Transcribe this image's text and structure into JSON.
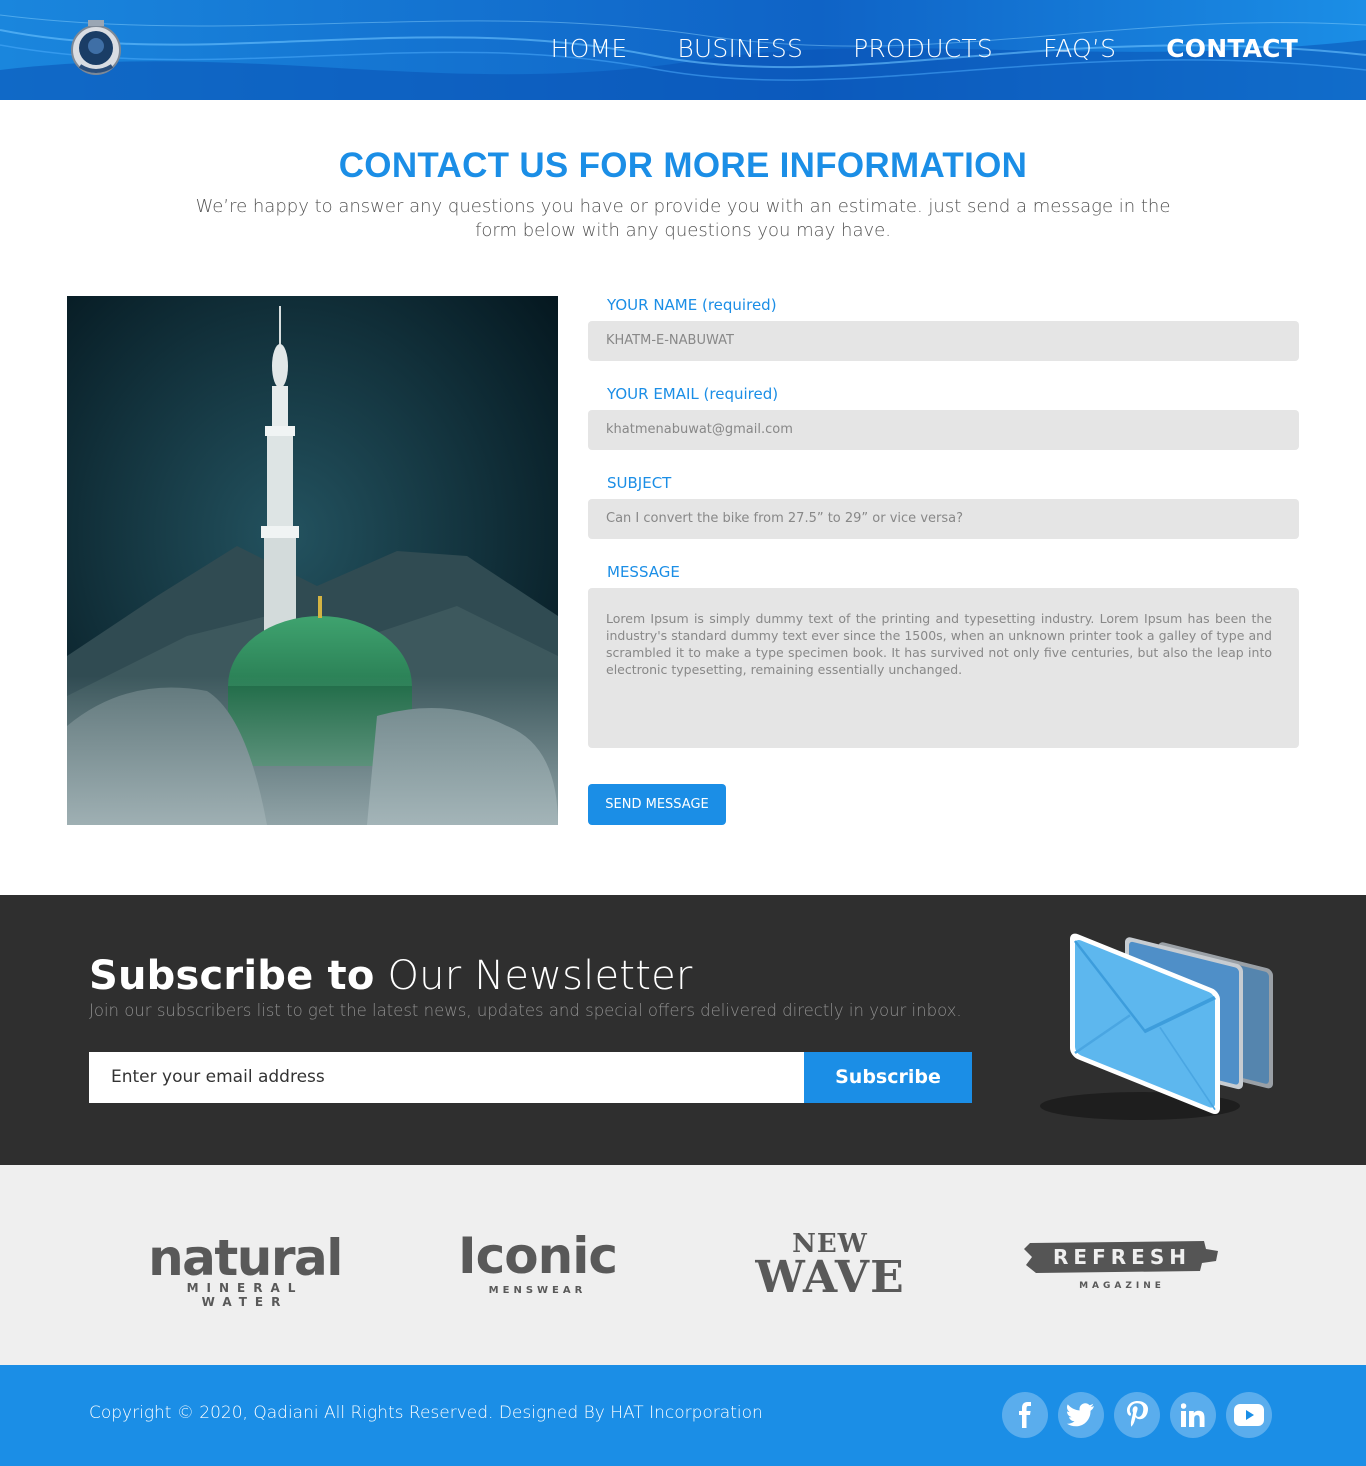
{
  "header": {
    "nav": [
      {
        "label": "HOME"
      },
      {
        "label": "BUSINESS"
      },
      {
        "label": "PRODUCTS"
      },
      {
        "label": "FAQ’S"
      },
      {
        "label": "CONTACT",
        "active": true
      }
    ]
  },
  "intro": {
    "title": "CONTACT US FOR MORE INFORMATION",
    "text": "We’re happy to answer any questions you have or provide you with an estimate. just send a message in the form below with any questions you may have."
  },
  "form": {
    "name_label": "YOUR NAME (required)",
    "name_value": "KHATM-E-NABUWAT",
    "email_label": "YOUR EMAIL (required)",
    "email_value": "khatmenabuwat@gmail.com",
    "subject_label": "SUBJECT",
    "subject_value": "Can I convert the bike from 27.5” to 29” or vice versa?",
    "message_label": "MESSAGE",
    "message_value": "Lorem Ipsum is simply dummy text of the printing and typesetting industry. Lorem Ipsum has been the industry's standard dummy text ever since the 1500s, when an unknown printer took a galley of type and scrambled it to make a type specimen book. It has survived not only five centuries, but also the leap into electronic typesetting, remaining essentially unchanged.",
    "send_label": "SEND MESSAGE"
  },
  "newsletter": {
    "title_bold": "Subscribe to",
    "title_light": "Our Newsletter",
    "subtitle": "Join our subscribers list to get the latest news, updates and special offers delivered directly in your inbox.",
    "placeholder": "Enter your email address",
    "button": "Subscribe"
  },
  "brands": {
    "natural": {
      "name": "natural",
      "tagline": "MINERAL WATER"
    },
    "iconic": {
      "name": "Iconic",
      "tagline": "MENSWEAR"
    },
    "wave": {
      "top": "NEW",
      "bottom": "WAVE"
    },
    "refresh": {
      "name": "REFRESH",
      "tagline": "MAGAZINE"
    }
  },
  "footer": {
    "copyright": "Copyright © 2020, Qadiani All Rights Reserved. Designed By HAT Incorporation",
    "socials": [
      "facebook-icon",
      "twitter-icon",
      "pinterest-icon",
      "linkedin-icon",
      "youtube-icon"
    ]
  },
  "colors": {
    "primary": "#1b8ee6",
    "dark": "#2f2f2f",
    "light_gray": "#efefef",
    "field": "#e5e5e5"
  }
}
